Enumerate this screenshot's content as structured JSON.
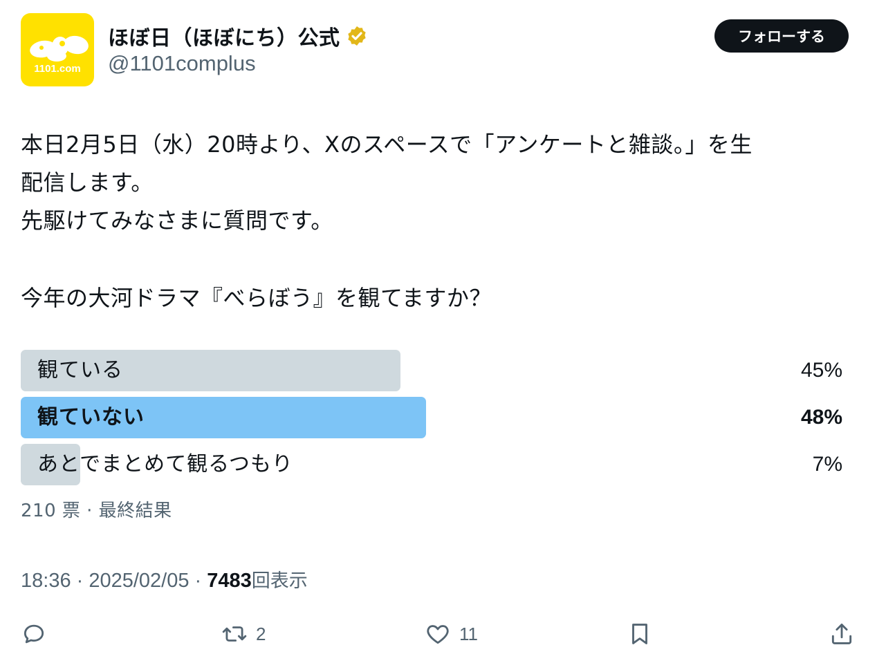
{
  "account": {
    "display_name": "ほぼ日（ほぼにち）公式",
    "handle": "@1101complus",
    "avatar_text": "1101.com",
    "verified": true
  },
  "follow_label": "フォローする",
  "body": {
    "line1": "本日2月5日（水）20時より、Xのスペースで「アンケートと雑談。」を生",
    "line2": "配信します。",
    "line3": "先駆けてみなさまに質問です。",
    "question": "今年の大河ドラマ『べらぼう』を観てますか？"
  },
  "poll": {
    "options": [
      {
        "label": "観ている",
        "percent_text": "45%",
        "percent": 45,
        "winner": false
      },
      {
        "label": "観ていない",
        "percent_text": "48%",
        "percent": 48,
        "winner": true
      },
      {
        "label": "あとでまとめて観るつもり",
        "percent_text": "7%",
        "percent": 7,
        "winner": false
      }
    ],
    "meta": "210 票 · 最終結果"
  },
  "timestamp": {
    "time_date": "18:36 · 2025/02/05 · ",
    "views": "7483",
    "views_label": "回表示"
  },
  "actions": {
    "reply_count": "",
    "retweet_count": "2",
    "like_count": "11"
  },
  "colors": {
    "winner_fill": "#7dc4f6",
    "loser_fill": "#cfd9de",
    "brand_yellow": "#ffe100",
    "verified_gold": "#e2b719"
  },
  "icons": [
    "verified-badge-icon",
    "reply-icon",
    "retweet-icon",
    "like-icon",
    "bookmark-icon",
    "share-icon"
  ]
}
